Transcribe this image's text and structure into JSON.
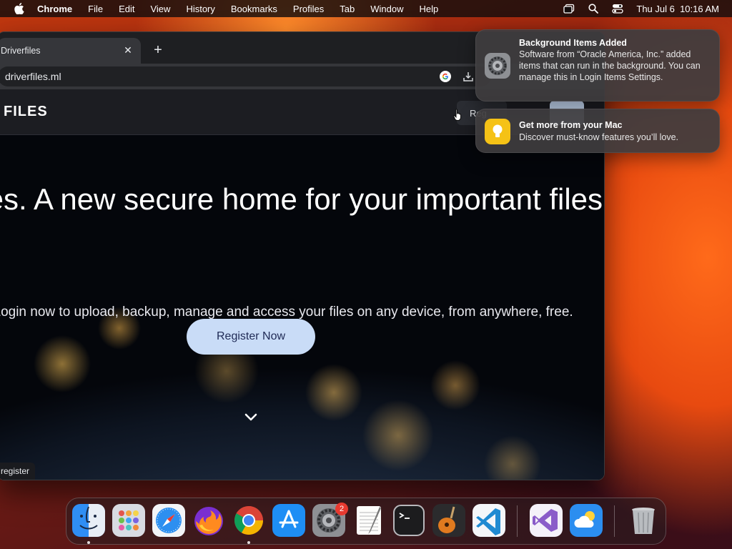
{
  "menubar": {
    "app_name": "Chrome",
    "items": [
      "File",
      "Edit",
      "View",
      "History",
      "Bookmarks",
      "Profiles",
      "Tab",
      "Window",
      "Help"
    ],
    "clock": "Thu Jul 6  10:16 AM"
  },
  "browser": {
    "tab_title": "Driverfiles",
    "url": "driverfiles.ml",
    "page": {
      "logo": "FILES",
      "nav_register_label": "Reg",
      "hero_title": "Driverfiles. A new secure home for your important files.",
      "hero_subtitle": "Register or Login now to upload, backup, manage and access your files on any device, from anywhere, free.",
      "register_button": "Register Now",
      "status_url": "register"
    }
  },
  "notifications": [
    {
      "title": "Background Items Added",
      "body": "Software from “Oracle America, Inc.” added items that can run in the background. You can manage this in Login Items Settings."
    },
    {
      "title": "Get more from your Mac",
      "body": "Discover must-know features you’ll love."
    }
  ],
  "dock": {
    "apps": [
      "Finder",
      "Launchpad",
      "Safari",
      "Firefox",
      "Chrome",
      "App Store",
      "System Settings",
      "TextEdit",
      "Terminal",
      "GarageBand",
      "Visual Studio Code",
      "Visual Studio",
      "Weather",
      "Trash"
    ],
    "settings_badge": "2"
  },
  "colors": {
    "accent_button": "#c9dcf7",
    "badge": "#e8392f"
  }
}
